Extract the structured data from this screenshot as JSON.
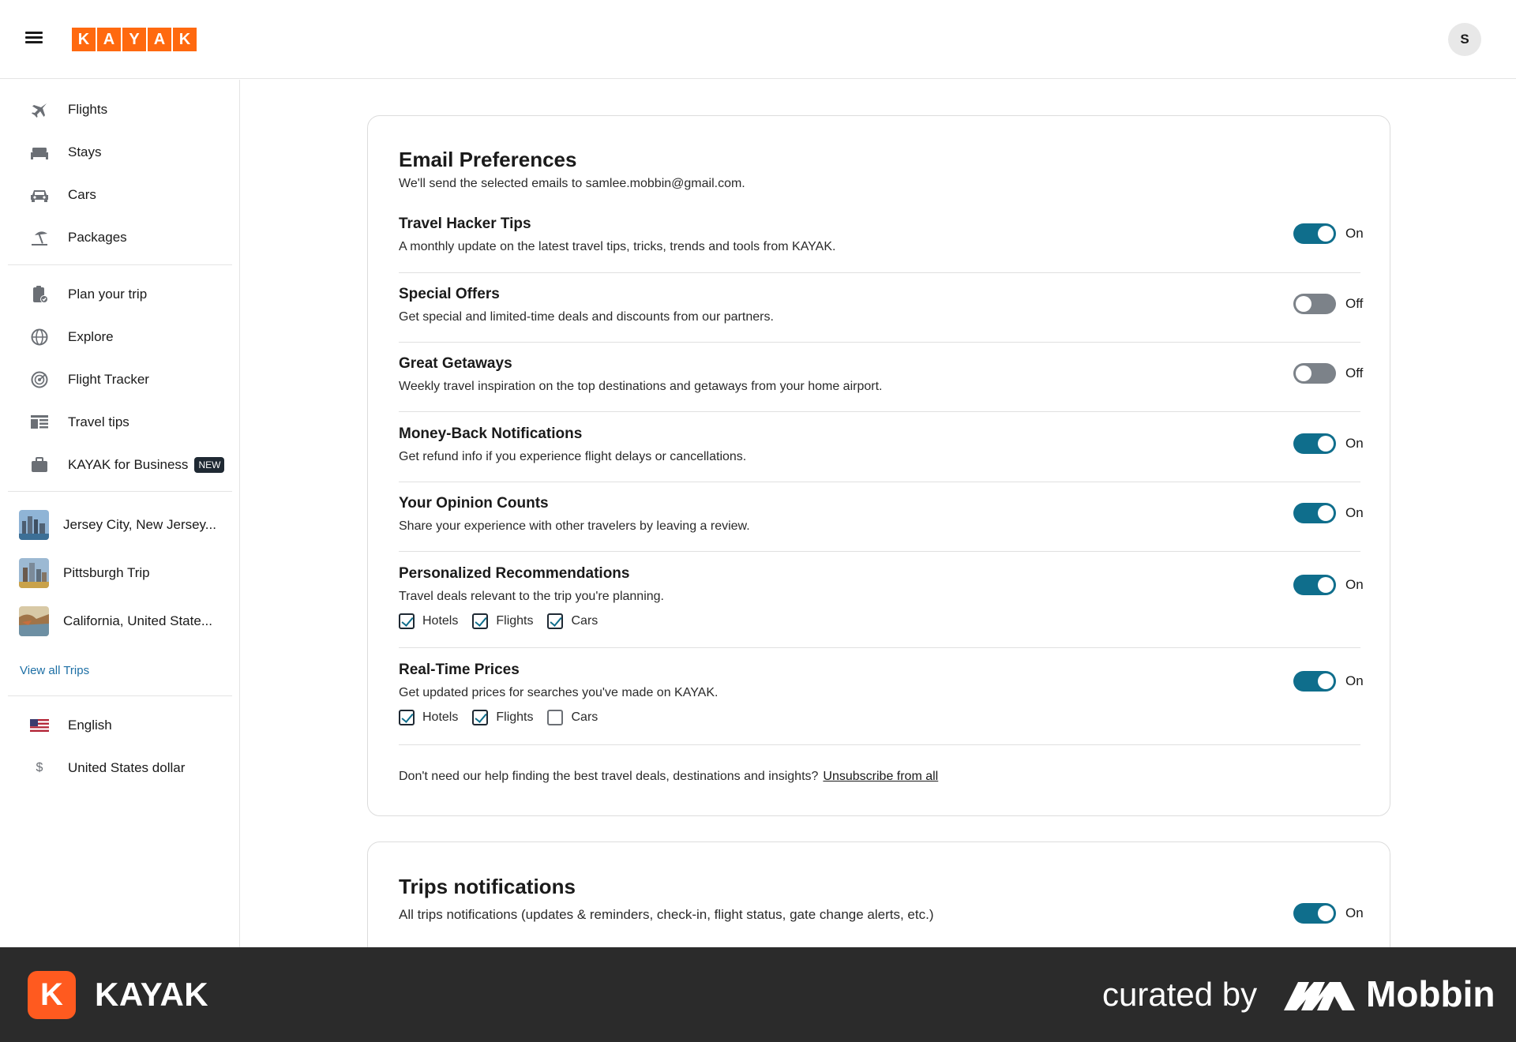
{
  "header": {
    "logo_letters": [
      "K",
      "A",
      "Y",
      "A",
      "K"
    ],
    "avatar_initial": "S"
  },
  "sidebar": {
    "nav": [
      {
        "label": "Flights",
        "icon": "plane-icon"
      },
      {
        "label": "Stays",
        "icon": "bed-icon"
      },
      {
        "label": "Cars",
        "icon": "car-icon"
      },
      {
        "label": "Packages",
        "icon": "beach-umbrella-icon"
      }
    ],
    "tools": [
      {
        "label": "Plan your trip",
        "icon": "clipboard-check-icon"
      },
      {
        "label": "Explore",
        "icon": "globe-icon"
      },
      {
        "label": "Flight Tracker",
        "icon": "radar-icon"
      },
      {
        "label": "Travel tips",
        "icon": "article-icon"
      },
      {
        "label": "KAYAK for Business",
        "icon": "briefcase-icon",
        "badge": "NEW"
      }
    ],
    "trips": [
      {
        "label": "Jersey City, New Jersey..."
      },
      {
        "label": "Pittsburgh Trip"
      },
      {
        "label": "California, United State..."
      }
    ],
    "view_all_trips": "View all Trips",
    "settings": [
      {
        "label": "English",
        "icon": "us-flag-icon"
      },
      {
        "label": "United States dollar",
        "icon": "dollar-icon",
        "glyph": "$"
      }
    ]
  },
  "email_prefs": {
    "title": "Email Preferences",
    "subtitle": "We'll send the selected emails to samlee.mobbin@gmail.com.",
    "items": [
      {
        "title": "Travel Hacker Tips",
        "desc": "A monthly update on the latest travel tips, tricks, trends and tools from KAYAK.",
        "state": "On"
      },
      {
        "title": "Special Offers",
        "desc": "Get special and limited-time deals and discounts from our partners.",
        "state": "Off"
      },
      {
        "title": "Great Getaways",
        "desc": "Weekly travel inspiration on the top destinations and getaways from your home airport.",
        "state": "Off"
      },
      {
        "title": "Money-Back Notifications",
        "desc": "Get refund info if you experience flight delays or cancellations.",
        "state": "On"
      },
      {
        "title": "Your Opinion Counts",
        "desc": "Share your experience with other travelers by leaving a review.",
        "state": "On"
      },
      {
        "title": "Personalized Recommendations",
        "desc": "Travel deals relevant to the trip you're planning.",
        "state": "On",
        "checks": [
          {
            "label": "Hotels",
            "checked": true
          },
          {
            "label": "Flights",
            "checked": true
          },
          {
            "label": "Cars",
            "checked": true
          }
        ]
      },
      {
        "title": "Real-Time Prices",
        "desc": "Get updated prices for searches you've made on KAYAK.",
        "state": "On",
        "checks": [
          {
            "label": "Hotels",
            "checked": true
          },
          {
            "label": "Flights",
            "checked": true
          },
          {
            "label": "Cars",
            "checked": false
          }
        ]
      }
    ],
    "footer_text": "Don't need our help finding the best travel deals, destinations and insights?",
    "unsubscribe_link": "Unsubscribe from all"
  },
  "trips_notifications": {
    "title": "Trips notifications",
    "desc": "All trips notifications (updates & reminders, check-in, flight status, gate change alerts, etc.)",
    "state": "On"
  },
  "banner": {
    "app_icon_letter": "K",
    "app_name": "KAYAK",
    "curated_by": "curated by",
    "brand": "Mobbin"
  },
  "colors": {
    "kayak_orange": "#ff690f",
    "toggle_on": "#0f6e8c",
    "toggle_off": "#7c8289"
  }
}
